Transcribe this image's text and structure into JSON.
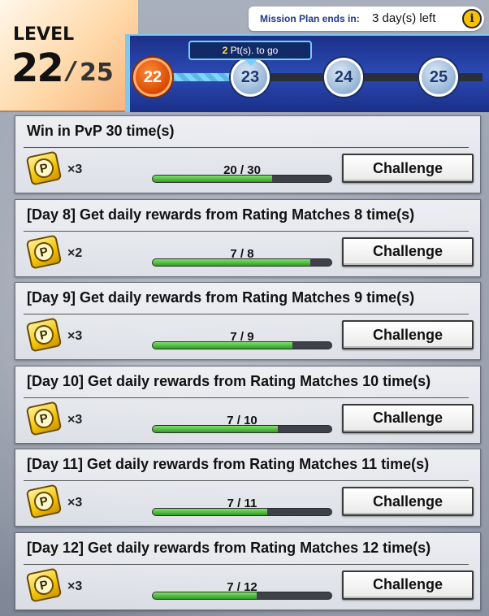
{
  "header": {
    "level_label": "LEVEL",
    "current_level": "22",
    "separator": "/",
    "max_level": "25",
    "plan_label": "Mission Plan ends in:",
    "plan_value": "3 day(s) left",
    "tooltip_points": "2",
    "tooltip_suffix": "Pt(s). to go",
    "nodes": [
      "22",
      "23",
      "24",
      "25"
    ],
    "info_icon": "info-icon"
  },
  "missions": [
    {
      "title": "Win in PvP 30 time(s)",
      "reward_qty": "×3",
      "progress_text": "20 / 30",
      "progress": 0.667,
      "button": "Challenge"
    },
    {
      "title": "[Day 8] Get daily rewards from Rating Matches 8 time(s)",
      "reward_qty": "×2",
      "progress_text": "7 / 8",
      "progress": 0.875,
      "button": "Challenge"
    },
    {
      "title": "[Day 9] Get daily rewards from Rating Matches 9 time(s)",
      "reward_qty": "×3",
      "progress_text": "7 / 9",
      "progress": 0.778,
      "button": "Challenge"
    },
    {
      "title": "[Day 10] Get daily rewards from Rating Matches 10 time(s)",
      "reward_qty": "×3",
      "progress_text": "7 / 10",
      "progress": 0.7,
      "button": "Challenge"
    },
    {
      "title": "[Day 11] Get daily rewards from Rating Matches 11 time(s)",
      "reward_qty": "×3",
      "progress_text": "7 / 11",
      "progress": 0.636,
      "button": "Challenge"
    },
    {
      "title": "[Day 12] Get daily rewards from Rating Matches 12 time(s)",
      "reward_qty": "×3",
      "progress_text": "7 / 12",
      "progress": 0.583,
      "button": "Challenge"
    }
  ],
  "reward_icon_letter": "P",
  "level_progress": 0.33,
  "colors": {
    "accent_blue": "#1a2f88",
    "progress_green": "#2f9e22",
    "node_done_orange": "#d84a00"
  }
}
